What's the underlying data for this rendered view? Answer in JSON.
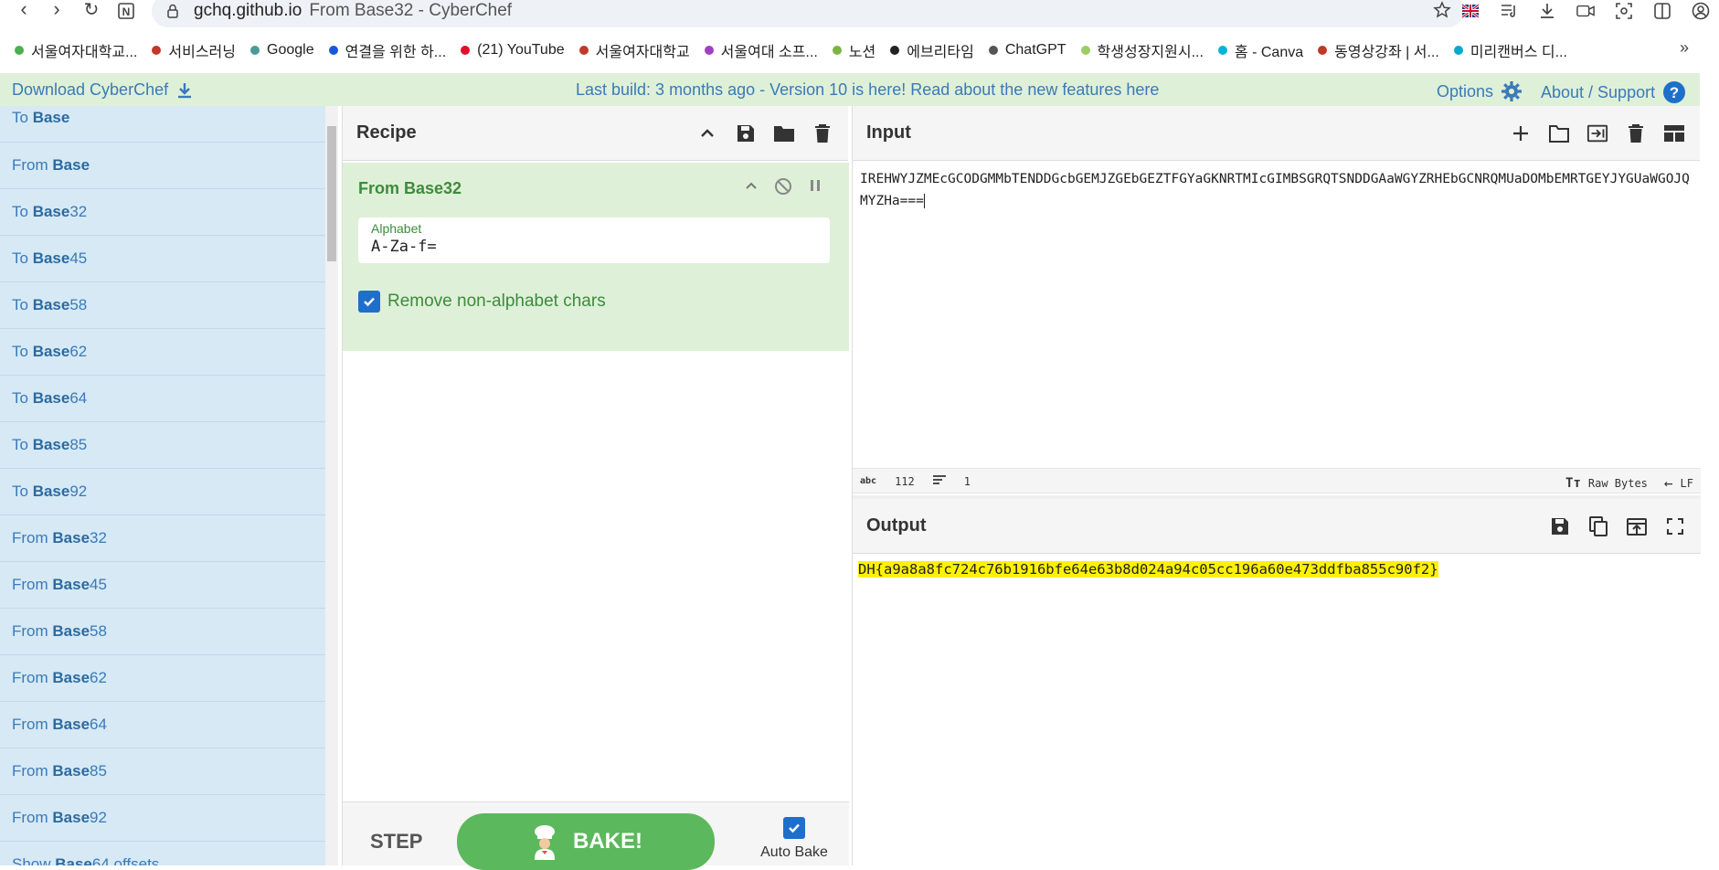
{
  "browser": {
    "domain": "gchq.github.io",
    "title": "From Base32 - CyberChef",
    "bookmarks": [
      {
        "label": "서울여자대학교...",
        "color": "#4caf50"
      },
      {
        "label": "서비스러닝",
        "color": "#c0392b"
      },
      {
        "label": "Google",
        "color": "#4a9a9a"
      },
      {
        "label": "연결을 위한 하...",
        "color": "#1a56db"
      },
      {
        "label": "(21) YouTube",
        "color": "#e0102a"
      },
      {
        "label": "서울여자대학교",
        "color": "#c0392b"
      },
      {
        "label": "서울여대 소프...",
        "color": "#a040c0"
      },
      {
        "label": "노션",
        "color": "#7cb342"
      },
      {
        "label": "에브리타임",
        "color": "#222222"
      },
      {
        "label": "ChatGPT",
        "color": "#555555"
      },
      {
        "label": "학생성장지원시...",
        "color": "#9ccc65"
      },
      {
        "label": "홈 - Canva",
        "color": "#00b4d8"
      },
      {
        "label": "동영상강좌 | 서...",
        "color": "#c0392b"
      },
      {
        "label": "미리캔버스 디...",
        "color": "#00aacc"
      }
    ]
  },
  "banner": {
    "download": "Download CyberChef",
    "build_msg": "Last build: 3 months ago - Version 10 is here! Read about the new features here",
    "options": "Options",
    "about": "About / Support"
  },
  "operations": [
    {
      "prefix": "To ",
      "bold": "Base",
      "suffix": ""
    },
    {
      "prefix": "From ",
      "bold": "Base",
      "suffix": ""
    },
    {
      "prefix": "To ",
      "bold": "Base",
      "suffix": "32"
    },
    {
      "prefix": "To ",
      "bold": "Base",
      "suffix": "45"
    },
    {
      "prefix": "To ",
      "bold": "Base",
      "suffix": "58"
    },
    {
      "prefix": "To ",
      "bold": "Base",
      "suffix": "62"
    },
    {
      "prefix": "To ",
      "bold": "Base",
      "suffix": "64"
    },
    {
      "prefix": "To ",
      "bold": "Base",
      "suffix": "85"
    },
    {
      "prefix": "To ",
      "bold": "Base",
      "suffix": "92"
    },
    {
      "prefix": "From ",
      "bold": "Base",
      "suffix": "32"
    },
    {
      "prefix": "From ",
      "bold": "Base",
      "suffix": "45"
    },
    {
      "prefix": "From ",
      "bold": "Base",
      "suffix": "58"
    },
    {
      "prefix": "From ",
      "bold": "Base",
      "suffix": "62"
    },
    {
      "prefix": "From ",
      "bold": "Base",
      "suffix": "64"
    },
    {
      "prefix": "From ",
      "bold": "Base",
      "suffix": "85"
    },
    {
      "prefix": "From ",
      "bold": "Base",
      "suffix": "92"
    },
    {
      "prefix": "Show ",
      "bold": "Base",
      "suffix": "64 offsets"
    }
  ],
  "recipe": {
    "title": "Recipe",
    "operation": "From Base32",
    "alphabet_label": "Alphabet",
    "alphabet_value": "A-Za-f=",
    "remove_label": "Remove non-alphabet chars",
    "step": "STEP",
    "bake": "BAKE!",
    "auto_bake": "Auto Bake"
  },
  "input": {
    "title": "Input",
    "text": "IREHWYJZMEcGCODGMMbTENDDGcbGEMJZGEbGEZTFGYaGKNRTMIcGIMBSGRQTSNDDGAaWGYZRHEbGCNRQMUaDOMbEMRTGEYJYGUaWGOJQMYZHa===",
    "char_count": "112",
    "line_count": "1",
    "encoding": "Raw Bytes",
    "eol": "LF"
  },
  "output": {
    "title": "Output",
    "text": "DH{a9a8a8fc724c76b1916bfe64e63b8d024a94c05cc196a60e473ddfba855c90f2}"
  }
}
